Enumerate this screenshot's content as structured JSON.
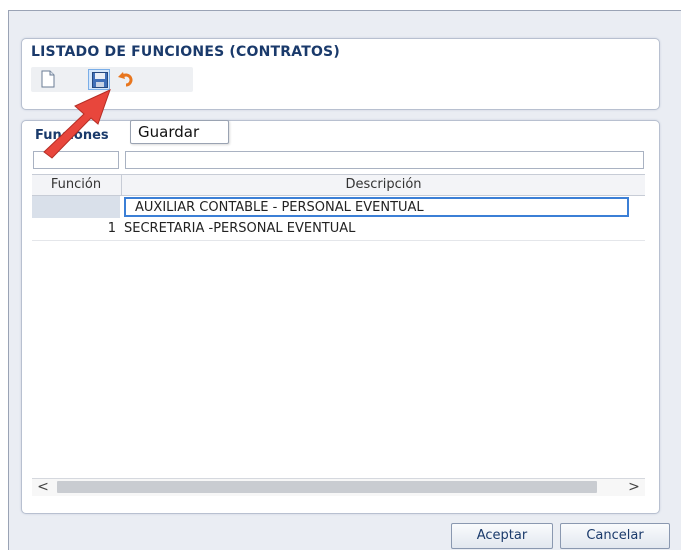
{
  "header": {
    "title": "LISTADO DE FUNCIONES (CONTRATOS)",
    "toolbar": {
      "buttons": [
        {
          "name": "new",
          "icon": "new-document-icon"
        },
        {
          "name": "save",
          "icon": "floppy-disk-icon"
        },
        {
          "name": "undo",
          "icon": "undo-arrow-icon"
        }
      ]
    }
  },
  "tooltip": {
    "text": "Guardar"
  },
  "list": {
    "section_title": "Funciones",
    "filters": {
      "funcion": "",
      "descripcion": ""
    },
    "columns": [
      "Función",
      "Descripción"
    ],
    "rows": [
      {
        "funcion": "",
        "descripcion": "AUXILIAR CONTABLE - PERSONAL EVENTUAL"
      },
      {
        "funcion": "1",
        "descripcion": "SECRETARIA -PERSONAL EVENTUAL"
      }
    ],
    "scrollbar": {
      "left_arrow": "<",
      "right_arrow": ">"
    }
  },
  "buttons": {
    "accept": "Aceptar",
    "cancel": "Cancelar"
  },
  "colors": {
    "title": "#1a3a6b",
    "selection_border": "#3b7fd6",
    "annotation_arrow": "#e8463c"
  }
}
